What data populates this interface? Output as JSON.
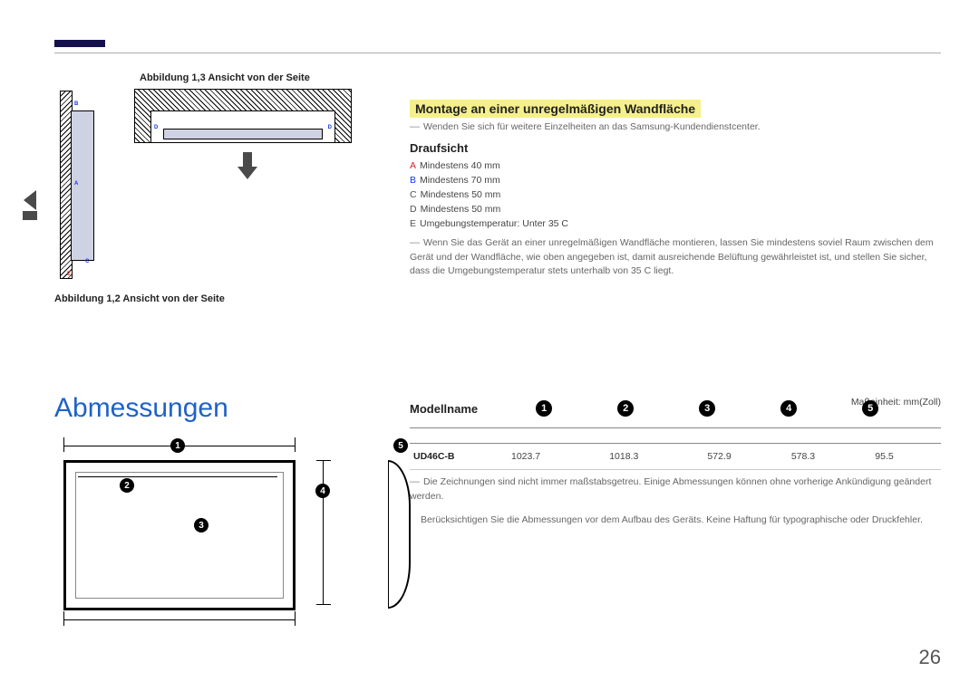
{
  "figures": {
    "caption_top": "Abbildung 1,3 Ansicht von der Seite",
    "caption_bottom": "Abbildung 1,2 Ansicht von der Seite",
    "side_labels": {
      "A": "A",
      "B": "B",
      "C": "C",
      "D": "D",
      "E": "E"
    }
  },
  "mounting": {
    "title": "Montage an einer unregelmäßigen Wandfläche",
    "note": "Wenden Sie sich für weitere Einzelheiten an das Samsung-Kundendienstcenter.",
    "subtitle": "Draufsicht",
    "specs": {
      "A": "Mindestens 40 mm",
      "B": "Mindestens 70 mm",
      "C": "Mindestens 50 mm",
      "D": "Mindestens 50 mm",
      "E": "Umgebungstemperatur: Unter 35 C"
    },
    "paragraph": "Wenn Sie das Gerät an einer unregelmäßigen Wandfläche montieren, lassen Sie mindestens soviel Raum zwischen dem Gerät und der Wandfläche, wie oben angegeben ist, damit ausreichende Belüftung gewährleistet ist, und stellen Sie sicher, dass die Umgebungstemperatur stets unterhalb von 35 C liegt."
  },
  "dimensions": {
    "heading": "Abmessungen",
    "model_label": "Modellname",
    "unit": "Maßeinheit: mm(Zoll)",
    "circles": {
      "c1": "1",
      "c2": "2",
      "c3": "3",
      "c4": "4",
      "c5": "5"
    },
    "table": {
      "headers": [
        "1",
        "2",
        "3",
        "4",
        "5"
      ],
      "row_model": "UD46C-B",
      "row_values": [
        "1023.7",
        "1018.3",
        "572.9",
        "578.3",
        "95.5"
      ]
    },
    "note1": "Die Zeichnungen sind nicht immer maßstabsgetreu. Einige Abmessungen können ohne vorherige Ankündigung geändert werden.",
    "note2": "Berücksichtigen Sie die Abmessungen vor dem Aufbau des Geräts. Keine Haftung für typographische oder Druckfehler."
  },
  "page_number": "26"
}
